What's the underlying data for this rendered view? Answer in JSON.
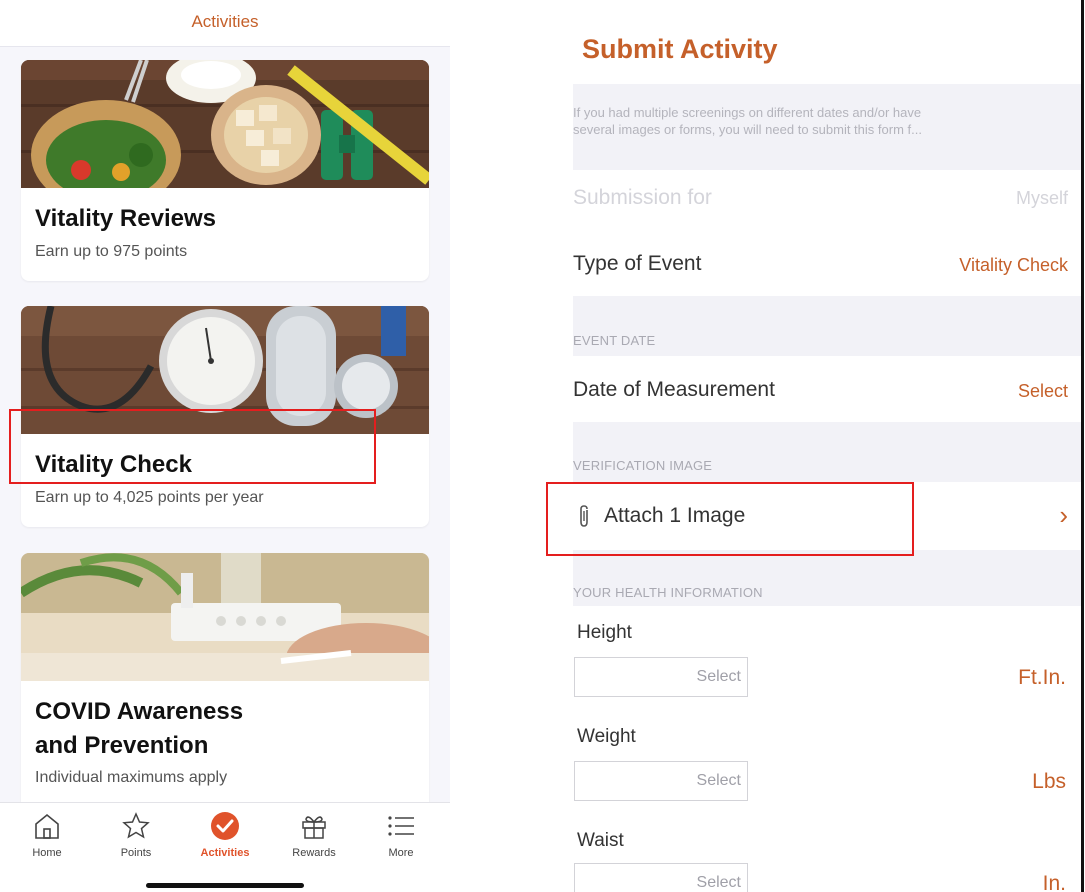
{
  "left": {
    "header_title": "Activities",
    "cards": [
      {
        "title": "Vitality Reviews",
        "subtitle": "Earn up to 975 points"
      },
      {
        "title": "Vitality Check",
        "subtitle": "Earn up to 4,025 points per year"
      },
      {
        "title_line1": "COVID Awareness",
        "title_line2": "and Prevention",
        "subtitle": "Individual maximums apply"
      }
    ],
    "tabs": [
      {
        "label": "Home",
        "icon": "home-icon"
      },
      {
        "label": "Points",
        "icon": "star-icon"
      },
      {
        "label": "Activities",
        "icon": "check-circle-icon"
      },
      {
        "label": "Rewards",
        "icon": "gift-icon"
      },
      {
        "label": "More",
        "icon": "menu-list-icon"
      }
    ],
    "active_tab": "Activities"
  },
  "right": {
    "title": "Submit Activity",
    "note_line1": "If you had multiple screenings on different dates and/or have",
    "note_line2": "several images or forms, you will need to submit this form f...",
    "submission_for": {
      "label": "Submission for",
      "value": "Myself"
    },
    "type_of_event": {
      "label": "Type of Event",
      "value": "Vitality Check"
    },
    "event_date_header": "EVENT DATE",
    "date_of_measurement": {
      "label": "Date of Measurement",
      "value": "Select"
    },
    "verification_header": "VERIFICATION IMAGE",
    "attach": {
      "label": "Attach 1 Image",
      "chevron": "›"
    },
    "health_header": "YOUR HEALTH INFORMATION",
    "fields": [
      {
        "label": "Height",
        "placeholder": "Select",
        "unit": "Ft.In."
      },
      {
        "label": "Weight",
        "placeholder": "Select",
        "unit": "Lbs"
      },
      {
        "label": "Waist",
        "placeholder": "Select",
        "unit": "In."
      }
    ]
  },
  "colors": {
    "accent": "#c5602a",
    "active_tab": "#e0532b",
    "highlight": "#e41e1e"
  }
}
